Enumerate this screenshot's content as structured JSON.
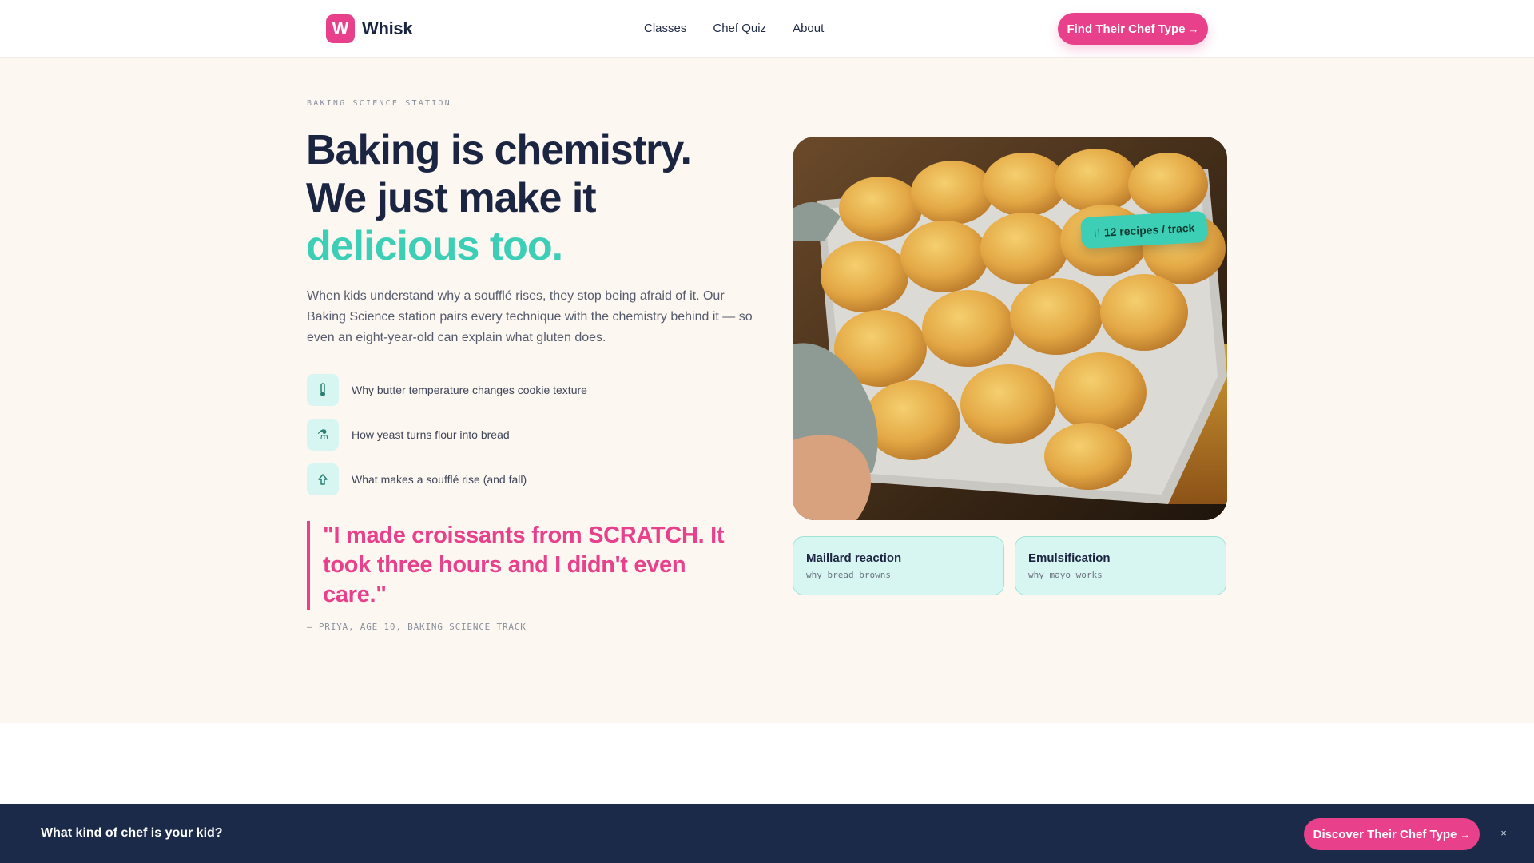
{
  "brand": {
    "logo_letter": "W",
    "name": "Whisk"
  },
  "nav": {
    "links": [
      "Classes",
      "Chef Quiz",
      "About"
    ],
    "cta_label": "Find Their Chef Type",
    "cta_icon": "arrow-right-icon"
  },
  "hero": {
    "eyebrow": "BAKING SCIENCE STATION",
    "headline_line1": "Baking is chemistry.",
    "headline_line2": "We just make it",
    "headline_accent": "delicious too.",
    "intro": "When kids understand why a soufflé rises, they stop being afraid of it. Our Baking Science station pairs every technique with the chemistry behind it — so even an eight-year-old can explain what gluten does.",
    "features": [
      {
        "icon": "thermometer-icon",
        "glyph": "",
        "text": "Why butter temperature changes cookie texture"
      },
      {
        "icon": "flask-icon",
        "glyph": "⚗",
        "text": "How yeast turns flour into bread"
      },
      {
        "icon": "rise-icon",
        "glyph": "",
        "text": "What makes a soufflé rise (and fall)"
      }
    ],
    "quote": "\"I made croissants from SCRATCH. It took three hours and I didn't even care.\"",
    "quote_cite": "— PRIYA, AGE 10, BAKING SCIENCE TRACK"
  },
  "photo": {
    "badge_text": "12 recipes / track",
    "badge_icon": "book-icon"
  },
  "cards": [
    {
      "title": "Maillard reaction",
      "subtitle": "why bread browns"
    },
    {
      "title": "Emulsification",
      "subtitle": "why mayo works"
    }
  ],
  "bottom_bar": {
    "question": "What kind of chef is your kid?",
    "cta_label": "Discover Their Chef Type",
    "close_label": "×"
  },
  "colors": {
    "brand_pink": "#e8408a",
    "accent_teal": "#3ccfb6",
    "navy": "#1b2a48",
    "hero_bg": "#fdf7f2"
  }
}
